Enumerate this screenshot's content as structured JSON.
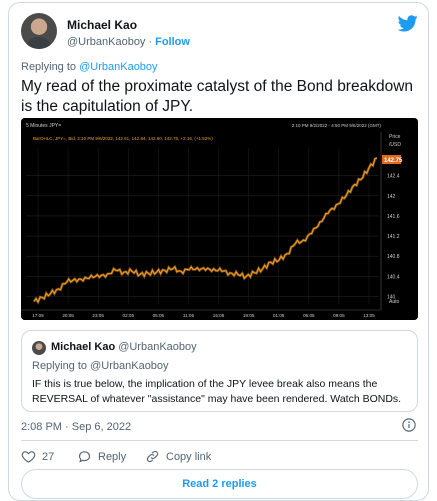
{
  "author": {
    "name": "Michael Kao",
    "handle": "@UrbanKaoboy",
    "separator": "·",
    "follow_label": "Follow"
  },
  "tweet": {
    "replying_prefix": "Replying to",
    "replying_to": "@UrbanKaoboy",
    "text": "My read of the proximate catalyst of the Bond breakdown is the capitulation of JPY."
  },
  "chart_image": {
    "top_left_label": "5 Minutes JPY=",
    "top_right_range": "2:10 PM 9/2/2022 - 4:50 PM 9/6/2022 (GMT)",
    "legend_line": "BarOHLC, JPY=, Bid, 2:10 PM 9/6/2022, 142.61, 142.84, 142.60, 142.75, +2.16, (+1.52%)",
    "axis_title_price": "Price",
    "axis_title_unit": "/USD",
    "current_price_badge": "142.75",
    "axis_footer": "Auto",
    "colors": {
      "line": "#f0a22a",
      "background": "#000000",
      "badge": "#e06a1b"
    }
  },
  "chart_data": {
    "type": "line",
    "title": "5 Minutes JPY=",
    "x_ticks": [
      "17:05",
      "20:05",
      "23:05",
      "02:05",
      "05:05",
      "11:05",
      "15:05",
      "19:05",
      "01:05",
      "05:05",
      "09:05",
      "13:05"
    ],
    "y_ticks": [
      142.4,
      142,
      141.6,
      141.2,
      140.8,
      140.4,
      140
    ],
    "ylim": [
      139.85,
      142.95
    ],
    "series": [
      {
        "values": [
          139.9,
          139.98,
          140.05,
          140.15,
          140.28,
          140.35,
          140.31,
          140.42,
          140.38,
          140.45,
          140.52,
          140.48,
          140.5,
          140.44,
          140.46,
          140.48,
          140.52,
          140.55,
          140.5,
          140.53,
          140.57,
          140.52,
          140.55,
          140.5,
          140.47,
          140.43,
          140.4,
          140.47,
          140.55,
          140.68,
          140.72,
          140.85,
          141.05,
          141.12,
          141.25,
          141.48,
          141.65,
          141.82,
          141.95,
          142.18,
          142.32,
          142.55,
          142.75
        ]
      }
    ]
  },
  "quote": {
    "name": "Michael Kao",
    "handle": "@UrbanKaoboy",
    "replying_prefix": "Replying to",
    "replying_to": "@UrbanKaoboy",
    "text": "IF this is true below, the implication of the JPY levee break also means the REVERSAL of whatever \"assistance\" may have been rendered. Watch BONDs."
  },
  "meta": {
    "timestamp": "2:08 PM · Sep 6, 2022"
  },
  "actions": {
    "like_count": "27",
    "reply_label": "Reply",
    "copy_label": "Copy link"
  },
  "read_replies_label": "Read 2 replies",
  "brand": {
    "twitter_blue": "#1d9bf0",
    "like_color": "#536471"
  },
  "icons": [
    "twitter-bird-icon",
    "info-icon",
    "heart-icon",
    "reply-icon",
    "link-icon"
  ]
}
